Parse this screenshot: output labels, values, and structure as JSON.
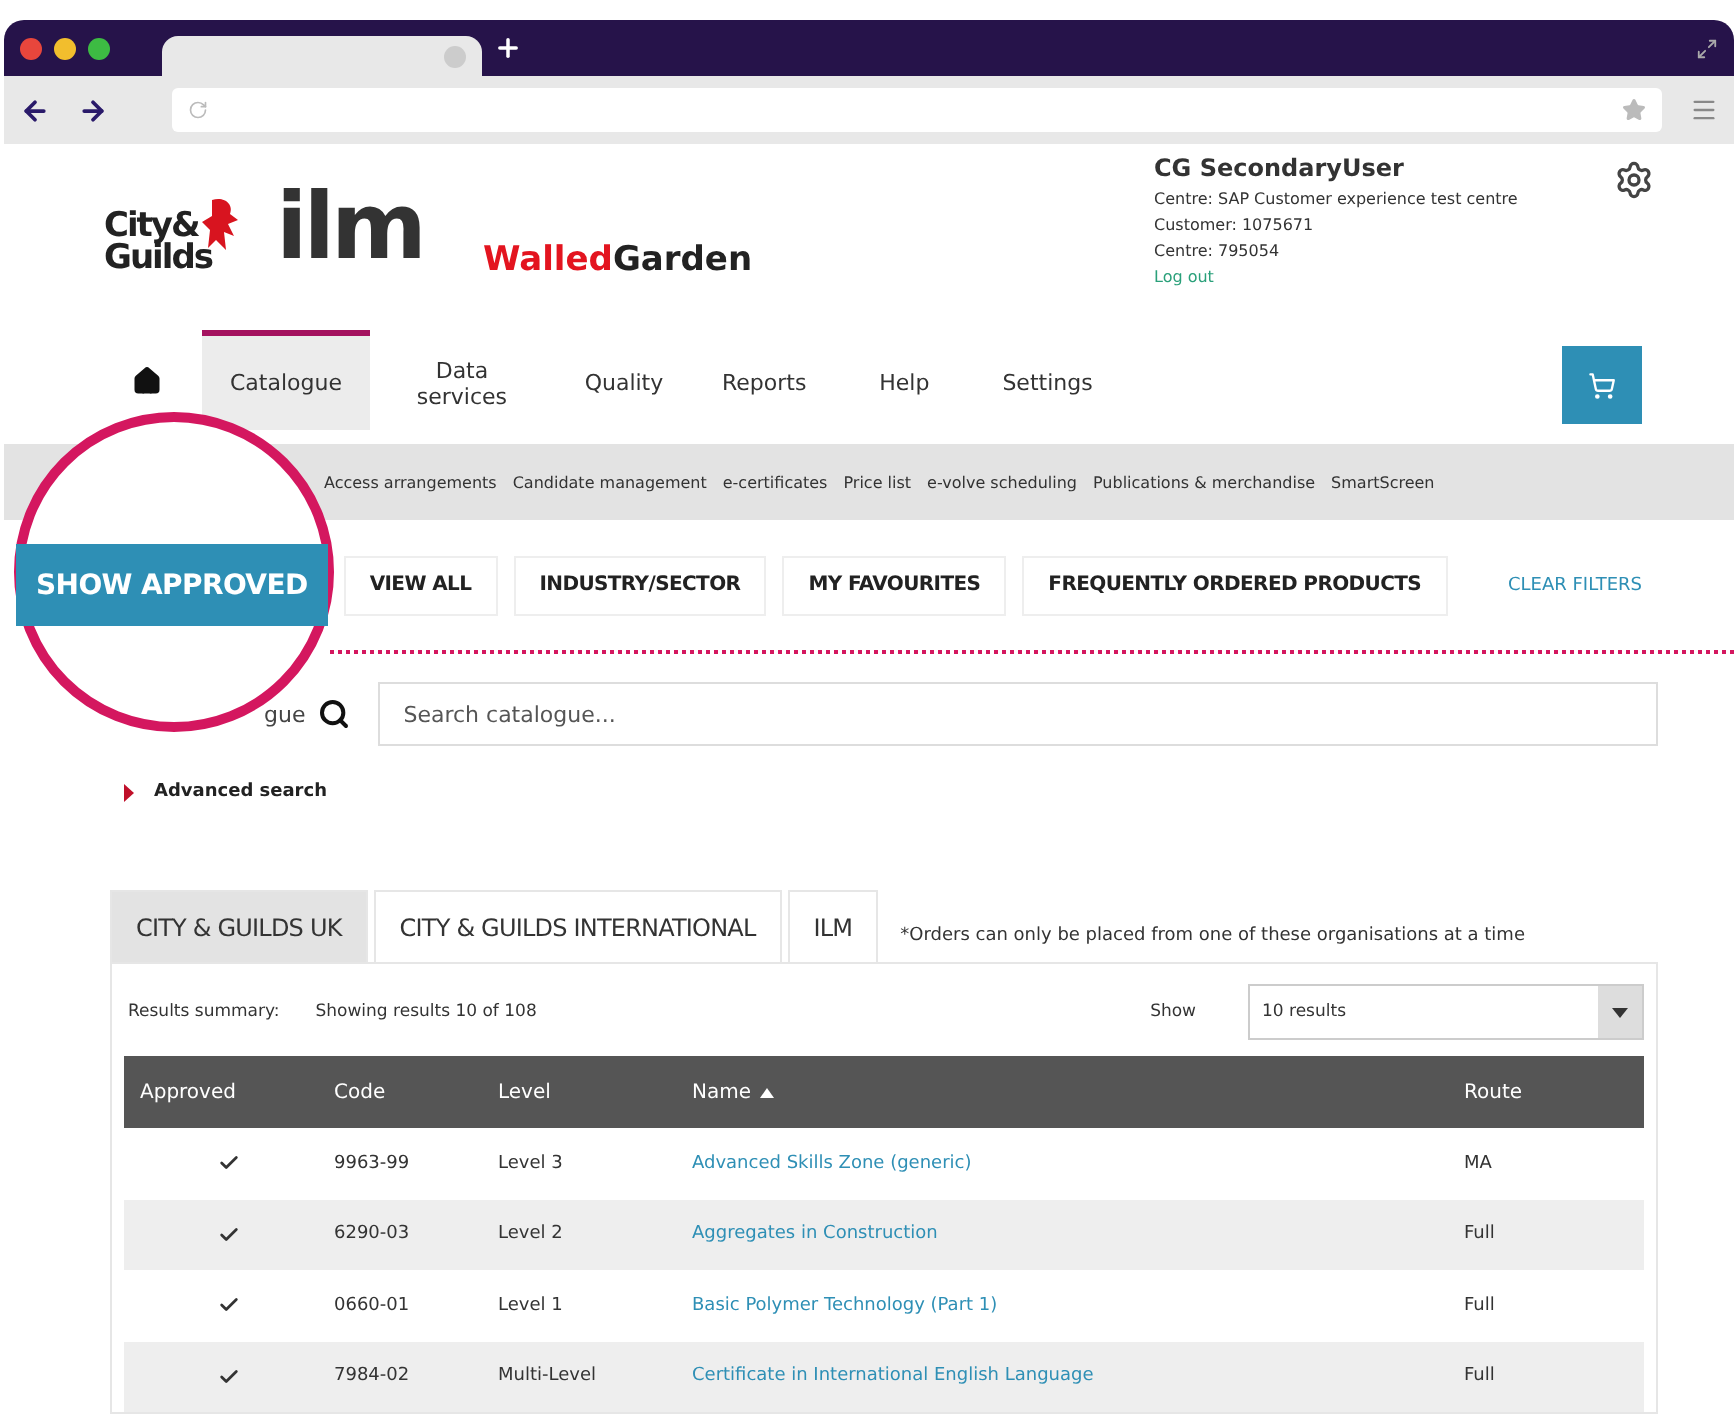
{
  "logos": {
    "city_guilds": [
      "City&",
      "Guilds"
    ],
    "ilm": "ilm",
    "walled_garden": [
      "Walled",
      "Garden"
    ]
  },
  "user": {
    "name": "CG SecondaryUser",
    "details": [
      "Centre:  SAP Customer experience test centre",
      "Customer:  1075671",
      "Centre:  795054"
    ],
    "logout": "Log out"
  },
  "nav": [
    {
      "label": "Catalogue",
      "selected": true
    },
    {
      "label": "Data services",
      "selected": false
    },
    {
      "label": "Quality",
      "selected": false
    },
    {
      "label": "Reports",
      "selected": false
    },
    {
      "label": "Help",
      "selected": false
    },
    {
      "label": "Settings",
      "selected": false
    }
  ],
  "subnav": [
    "Access arrangements",
    "Candidate management",
    "e-certificates",
    "Price list",
    "e-volve scheduling",
    "Publications & merchandise",
    "SmartScreen"
  ],
  "filters": [
    {
      "label": "SHOW APPROVED",
      "selected": true
    },
    {
      "label": "VIEW ALL",
      "selected": false
    },
    {
      "label": "INDUSTRY/SECTOR",
      "selected": false
    },
    {
      "label": "MY FAVOURITES",
      "selected": false
    },
    {
      "label": "FREQUENTLY ORDERED PRODUCTS",
      "selected": false
    }
  ],
  "clear_filters": "CLEAR FILTERS",
  "search": {
    "label": "gue",
    "placeholder": "Search catalogue..."
  },
  "advanced_search": "Advanced search",
  "org_tabs": [
    {
      "label": "CITY & GUILDS UK",
      "selected": true
    },
    {
      "label": "CITY & GUILDS INTERNATIONAL",
      "selected": false
    },
    {
      "label": "ILM",
      "selected": false
    }
  ],
  "org_note": "*Orders can only be placed from one of these organisations at a time",
  "results": {
    "summary_label": "Results summary:",
    "summary": "Showing results 10 of 108",
    "show_label": "Show",
    "show_value": "10 results"
  },
  "table": {
    "columns": [
      "Approved",
      "Code",
      "Level",
      "Name",
      "Route"
    ],
    "rows": [
      {
        "approved": true,
        "code": "9963-99",
        "level": "Level 3",
        "name": "Advanced Skills Zone (generic)",
        "route": "MA"
      },
      {
        "approved": true,
        "code": "6290-03",
        "level": "Level 2",
        "name": "Aggregates in Construction",
        "route": "Full"
      },
      {
        "approved": true,
        "code": "0660-01",
        "level": "Level 1",
        "name": "Basic Polymer Technology (Part 1)",
        "route": "Full"
      },
      {
        "approved": true,
        "code": "7984-02",
        "level": "Multi-Level",
        "name": "Certificate in International English Language",
        "route": "Full"
      }
    ]
  }
}
